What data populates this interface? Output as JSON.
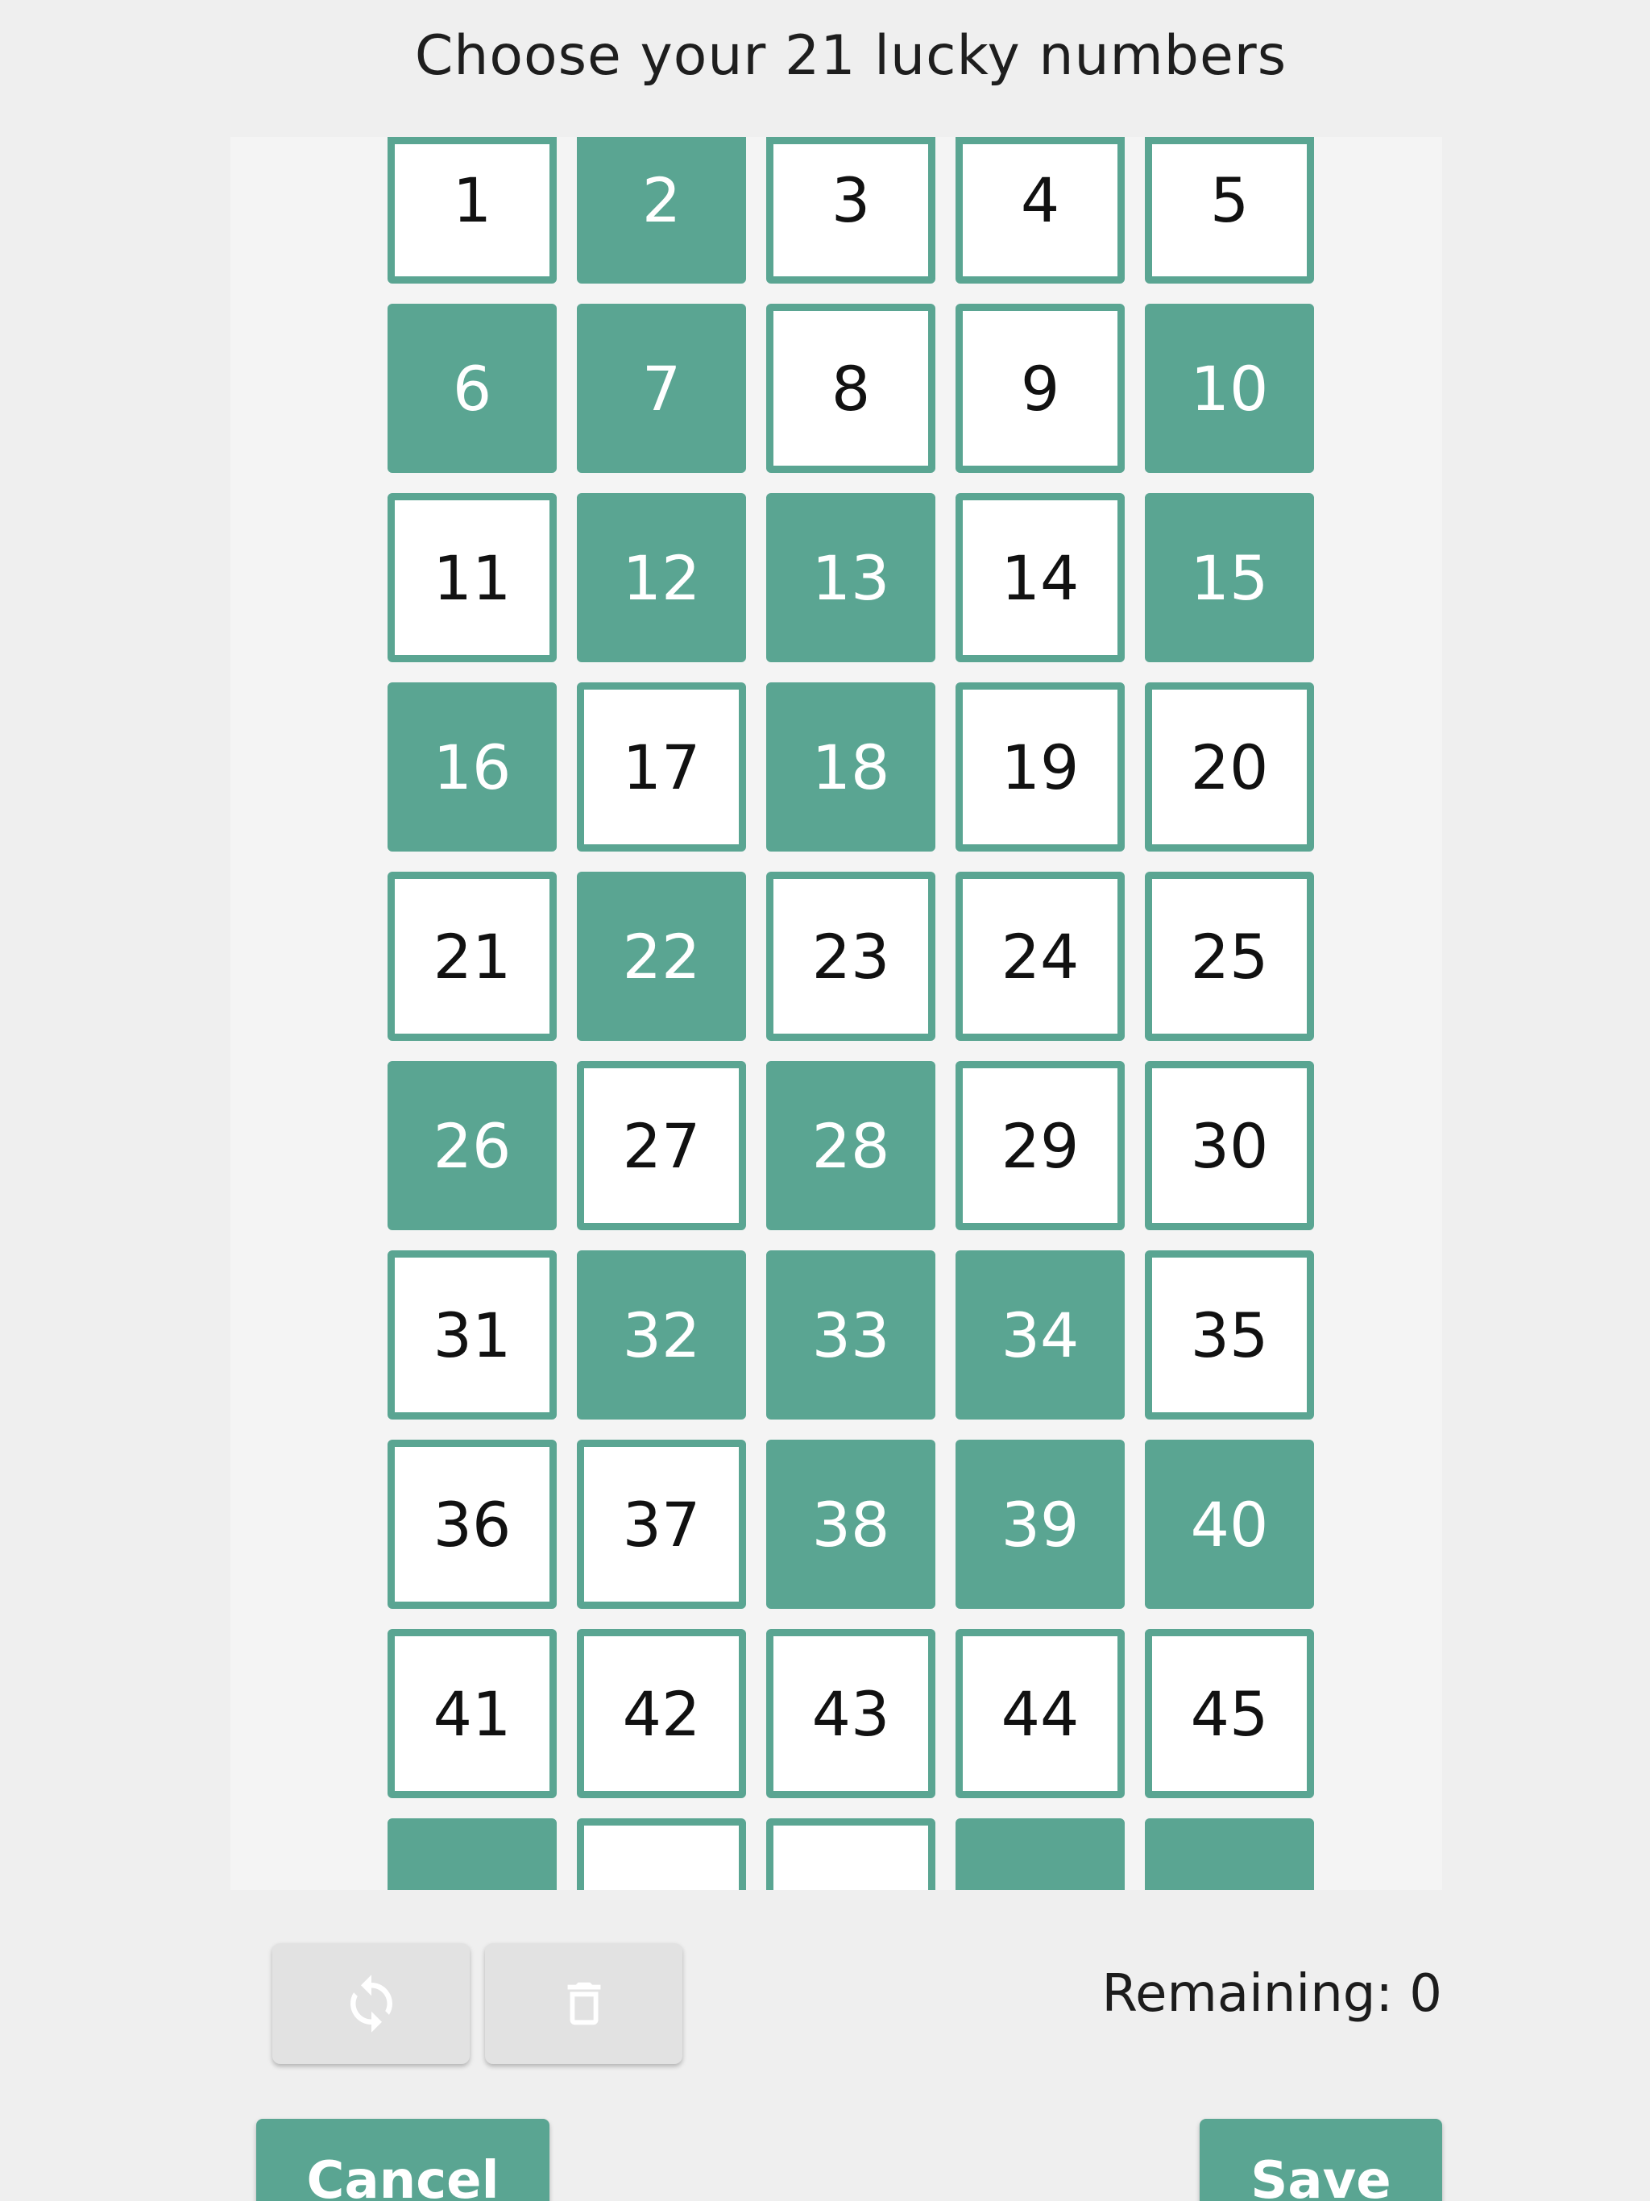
{
  "header": {
    "title": "Choose your 21 lucky numbers"
  },
  "grid": {
    "numbers": [
      "1",
      "2",
      "3",
      "4",
      "5",
      "6",
      "7",
      "8",
      "9",
      "10",
      "11",
      "12",
      "13",
      "14",
      "15",
      "16",
      "17",
      "18",
      "19",
      "20",
      "21",
      "22",
      "23",
      "24",
      "25",
      "26",
      "27",
      "28",
      "29",
      "30",
      "31",
      "32",
      "33",
      "34",
      "35",
      "36",
      "37",
      "38",
      "39",
      "40",
      "41",
      "42",
      "43",
      "44",
      "45",
      "",
      "",
      "",
      "",
      ""
    ],
    "selected": [
      false,
      true,
      false,
      false,
      false,
      true,
      true,
      false,
      false,
      true,
      false,
      true,
      true,
      false,
      true,
      true,
      false,
      true,
      false,
      false,
      false,
      true,
      false,
      false,
      false,
      true,
      false,
      true,
      false,
      false,
      false,
      true,
      true,
      true,
      false,
      false,
      false,
      true,
      true,
      true,
      false,
      false,
      false,
      false,
      false,
      true,
      false,
      false,
      true,
      true
    ]
  },
  "toolbar": {
    "refresh_icon": "refresh-icon",
    "delete_icon": "trash-icon",
    "remaining_text": "Remaining: 0"
  },
  "actions": {
    "cancel_label": "Cancel",
    "save_label": "Save"
  },
  "colors": {
    "accent": "#5aa592",
    "background": "#efefef",
    "panel": "#f4f4f4"
  }
}
